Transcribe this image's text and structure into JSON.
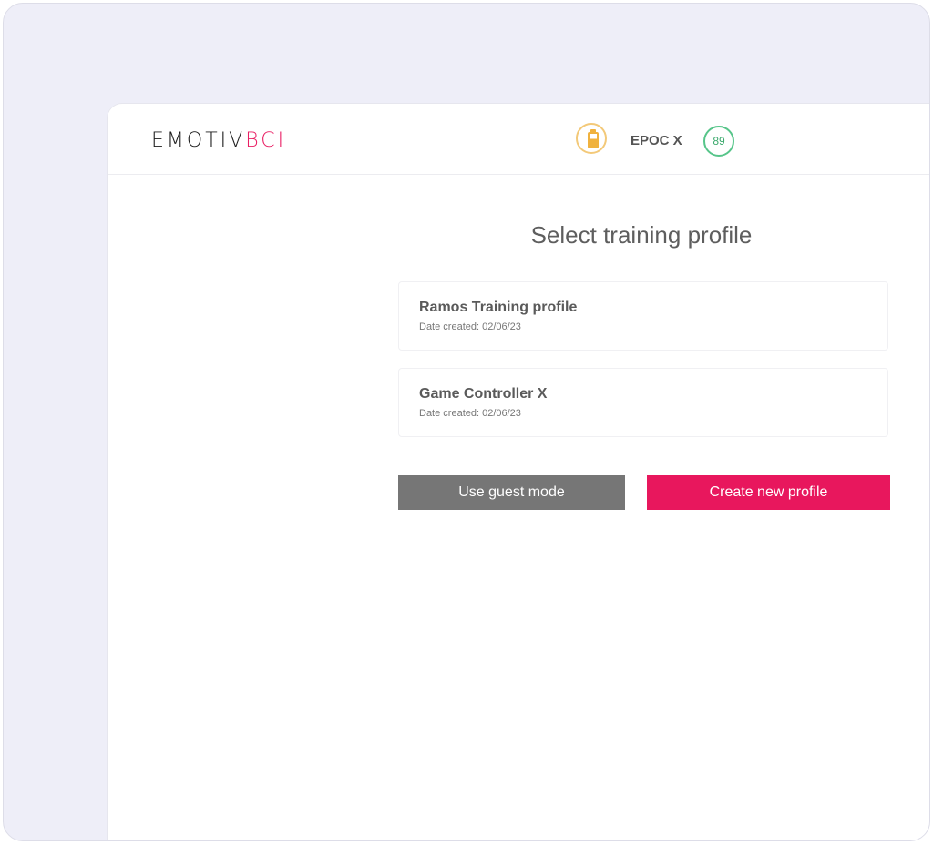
{
  "header": {
    "logo_main": "EMOTIV",
    "logo_accent": "BCI",
    "device_name": "EPOC X",
    "signal_value": "89"
  },
  "main": {
    "title": "Select training profile",
    "profiles": [
      {
        "name": "Ramos Training profile",
        "date": "Date created: 02/06/23"
      },
      {
        "name": "Game Controller X",
        "date": "Date created: 02/06/23"
      }
    ],
    "guest_button": "Use guest mode",
    "create_button": "Create new profile"
  },
  "colors": {
    "accent": "#e8175d",
    "battery": "#f0b23e",
    "signal": "#57c58a",
    "guest_button": "#767676"
  },
  "icons": {
    "battery": "battery-icon",
    "signal": "signal-quality-icon"
  }
}
